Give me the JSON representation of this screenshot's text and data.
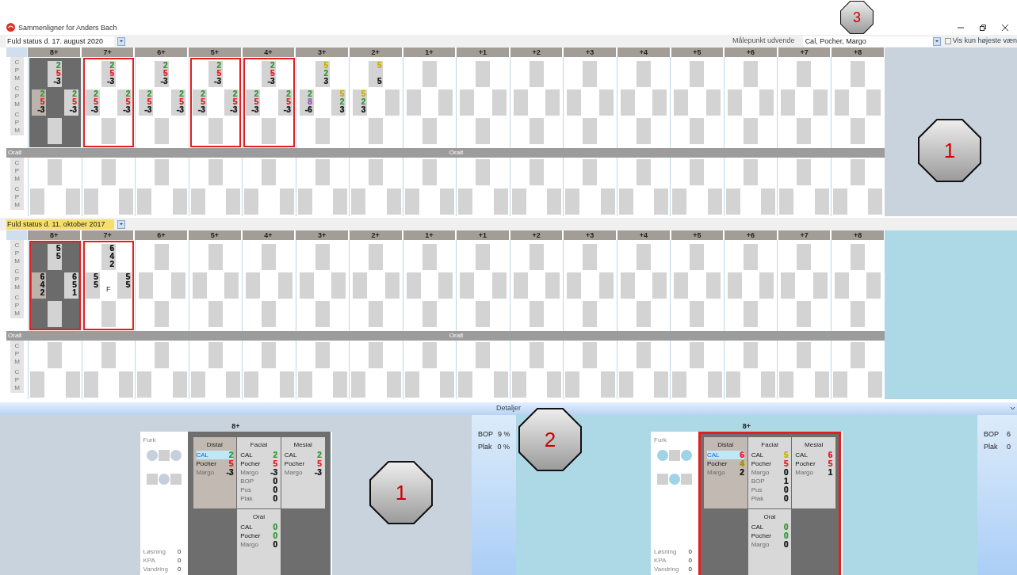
{
  "window": {
    "title": "Sammenligner for Anders Bach"
  },
  "toolbar": {
    "measure_label": "Målepunkt udvende",
    "measure_value": "Cal, Pocher, Margo",
    "highest_only": {
      "label": "Vis kun højeste væn",
      "checked": false
    }
  },
  "charts": [
    {
      "date": "Fuld status d. 17. august 2020",
      "date_highlighted": false,
      "oral_label": "Oralt",
      "oral_center_label": "Oralt",
      "buccal_row_labels": [
        [
          "C",
          "P",
          "M"
        ],
        [
          "C",
          "P",
          "M"
        ],
        [
          "C",
          "P",
          "M"
        ]
      ],
      "oral_row_labels": [
        [
          "C",
          "P",
          "M"
        ],
        [
          "C",
          "P",
          "M"
        ]
      ],
      "teeth": [
        {
          "label": "8+",
          "missing": true,
          "marked": false,
          "top": {
            "c": {
              "text": "2",
              "color": "#3c9a3c"
            },
            "p": {
              "text": "5",
              "color": "#e8262b"
            },
            "m": {
              "text": "-3",
              "color": "#222222"
            }
          },
          "left": {
            "c": {
              "text": "2",
              "color": "#3c9a3c"
            },
            "p": {
              "text": "5",
              "color": "#e8262b"
            },
            "m": {
              "text": "-3",
              "color": "#222222"
            }
          },
          "right": {
            "c": {
              "text": "2",
              "color": "#3c9a3c"
            },
            "p": {
              "text": "5",
              "color": "#e8262b"
            },
            "m": {
              "text": "-3",
              "color": "#222222"
            }
          }
        },
        {
          "label": "7+",
          "missing": false,
          "marked": true,
          "top": {
            "c": {
              "text": "2",
              "color": "#3c9a3c"
            },
            "p": {
              "text": "5",
              "color": "#e8262b"
            },
            "m": {
              "text": "-3",
              "color": "#222222"
            }
          },
          "left": {
            "c": {
              "text": "2",
              "color": "#3c9a3c"
            },
            "p": {
              "text": "5",
              "color": "#e8262b"
            },
            "m": {
              "text": "-3",
              "color": "#222222"
            }
          },
          "right": {
            "c": {
              "text": "2",
              "color": "#3c9a3c"
            },
            "p": {
              "text": "5",
              "color": "#e8262b"
            },
            "m": {
              "text": "-3",
              "color": "#222222"
            }
          }
        },
        {
          "label": "6+",
          "missing": false,
          "marked": false,
          "top": {
            "c": {
              "text": "2",
              "color": "#3c9a3c"
            },
            "p": {
              "text": "5",
              "color": "#e8262b"
            },
            "m": {
              "text": "-3",
              "color": "#222222"
            }
          },
          "left": {
            "c": {
              "text": "2",
              "color": "#3c9a3c"
            },
            "p": {
              "text": "5",
              "color": "#e8262b"
            },
            "m": {
              "text": "-3",
              "color": "#222222"
            }
          },
          "right": {
            "c": {
              "text": "2",
              "color": "#3c9a3c"
            },
            "p": {
              "text": "5",
              "color": "#e8262b"
            },
            "m": {
              "text": "-3",
              "color": "#222222"
            }
          }
        },
        {
          "label": "5+",
          "missing": false,
          "marked": true,
          "top": {
            "c": {
              "text": "2",
              "color": "#3c9a3c"
            },
            "p": {
              "text": "5",
              "color": "#e8262b"
            },
            "m": {
              "text": "-3",
              "color": "#222222"
            }
          },
          "left": {
            "c": {
              "text": "2",
              "color": "#3c9a3c"
            },
            "p": {
              "text": "5",
              "color": "#e8262b"
            },
            "m": {
              "text": "-3",
              "color": "#222222"
            }
          },
          "right": {
            "c": {
              "text": "2",
              "color": "#3c9a3c"
            },
            "p": {
              "text": "5",
              "color": "#e8262b"
            },
            "m": {
              "text": "-3",
              "color": "#222222"
            }
          }
        },
        {
          "label": "4+",
          "missing": false,
          "marked": true,
          "top": {
            "c": {
              "text": "2",
              "color": "#3c9a3c"
            },
            "p": {
              "text": "5",
              "color": "#e8262b"
            },
            "m": {
              "text": "-3",
              "color": "#222222"
            }
          },
          "left": {
            "c": {
              "text": "2",
              "color": "#3c9a3c"
            },
            "p": {
              "text": "5",
              "color": "#e8262b"
            },
            "m": {
              "text": "-3",
              "color": "#222222"
            }
          },
          "right": {
            "c": {
              "text": "2",
              "color": "#3c9a3c"
            },
            "p": {
              "text": "5",
              "color": "#e8262b"
            },
            "m": {
              "text": "-3",
              "color": "#222222"
            }
          }
        },
        {
          "label": "3+",
          "missing": false,
          "marked": false,
          "top": {
            "c": {
              "text": "5",
              "color": "#c9b400"
            },
            "p": {
              "text": "2",
              "color": "#3c9a3c"
            },
            "m": {
              "text": "3",
              "color": "#222222"
            }
          },
          "left": {
            "c": {
              "text": "2",
              "color": "#3c9a3c"
            },
            "p": {
              "text": "8",
              "color": "#9b59b6"
            },
            "m": {
              "text": "-6",
              "color": "#222222"
            }
          },
          "right": {
            "c": {
              "text": "5",
              "color": "#c9b400"
            },
            "p": {
              "text": "2",
              "color": "#3c9a3c"
            },
            "m": {
              "text": "3",
              "color": "#222222"
            }
          }
        },
        {
          "label": "2+",
          "missing": false,
          "marked": false,
          "top": {
            "c": {
              "text": "5",
              "color": "#c9b400"
            },
            "m": {
              "text": "5",
              "color": "#222222"
            }
          },
          "left": {
            "c": {
              "text": "5",
              "color": "#c9b400"
            },
            "p": {
              "text": "2",
              "color": "#3c9a3c"
            },
            "m": {
              "text": "3",
              "color": "#222222"
            }
          }
        },
        {
          "label": "1+",
          "missing": false,
          "marked": false
        },
        {
          "label": "+1",
          "missing": false,
          "marked": false
        },
        {
          "label": "+2",
          "missing": false,
          "marked": false
        },
        {
          "label": "+3",
          "missing": false,
          "marked": false
        },
        {
          "label": "+4",
          "missing": false,
          "marked": false
        },
        {
          "label": "+5",
          "missing": false,
          "marked": false
        },
        {
          "label": "+6",
          "missing": false,
          "marked": false
        },
        {
          "label": "+7",
          "missing": false,
          "marked": false
        },
        {
          "label": "+8",
          "missing": false,
          "marked": false
        }
      ]
    },
    {
      "date": "Fuld status d. 11. oktober 2017",
      "date_highlighted": true,
      "oral_label": "Oralt",
      "oral_center_label": "Oralt",
      "buccal_row_labels": [
        [
          "C",
          "P",
          "M"
        ],
        [
          "C",
          "P",
          "M"
        ],
        [
          "C",
          "P",
          "M"
        ]
      ],
      "oral_row_labels": [
        [
          "C",
          "P",
          "M"
        ],
        [
          "C",
          "P",
          "M"
        ]
      ],
      "teeth": [
        {
          "label": "8+",
          "missing": true,
          "marked": true,
          "top": {
            "c": {
              "text": "5",
              "color": "#222222"
            },
            "p": {
              "text": "5",
              "color": "#222222"
            }
          },
          "left": {
            "c": {
              "text": "6",
              "color": "#222222"
            },
            "p": {
              "text": "4",
              "color": "#222222"
            },
            "m": {
              "text": "2",
              "color": "#222222"
            }
          },
          "right": {
            "c": {
              "text": "6",
              "color": "#222222"
            },
            "p": {
              "text": "5",
              "color": "#222222"
            },
            "m": {
              "text": "1",
              "color": "#222222"
            }
          }
        },
        {
          "label": "7+",
          "missing": false,
          "marked": true,
          "top": {
            "c": {
              "text": "6",
              "color": "#222222"
            },
            "p": {
              "text": "4",
              "color": "#222222"
            },
            "m": {
              "text": "2",
              "color": "#222222"
            }
          },
          "left": {
            "c": {
              "text": "5",
              "color": "#222222"
            },
            "p": {
              "text": "5",
              "color": "#222222"
            }
          },
          "right": {
            "c": {
              "text": "5",
              "color": "#222222"
            },
            "p": {
              "text": "5",
              "color": "#222222"
            }
          },
          "center": "F"
        },
        {
          "label": "6+",
          "missing": false,
          "marked": false
        },
        {
          "label": "5+",
          "missing": false,
          "marked": false
        },
        {
          "label": "4+",
          "missing": false,
          "marked": false
        },
        {
          "label": "3+",
          "missing": false,
          "marked": false
        },
        {
          "label": "2+",
          "missing": false,
          "marked": false
        },
        {
          "label": "1+",
          "missing": false,
          "marked": false
        },
        {
          "label": "+1",
          "missing": false,
          "marked": false
        },
        {
          "label": "+2",
          "missing": false,
          "marked": false
        },
        {
          "label": "+3",
          "missing": false,
          "marked": false
        },
        {
          "label": "+4",
          "missing": false,
          "marked": false
        },
        {
          "label": "+5",
          "missing": false,
          "marked": false
        },
        {
          "label": "+6",
          "missing": false,
          "marked": false
        },
        {
          "label": "+7",
          "missing": false,
          "marked": false
        },
        {
          "label": "+8",
          "missing": false,
          "marked": false
        }
      ]
    }
  ],
  "details": {
    "title": "Detaljer",
    "panels": [
      {
        "tooth": "8+",
        "marked": false,
        "furcation": {
          "label": "Furk",
          "color": "#c5d0dc"
        },
        "sections": [
          {
            "name": "Distal",
            "selected": true,
            "rows": [
              {
                "label": "CAL",
                "value": "2",
                "color": "#3c9a3c",
                "dim": false,
                "selected": true
              },
              {
                "label": "Pocher",
                "value": "5",
                "color": "#e8262b",
                "dim": false,
                "selected": false
              },
              {
                "label": "Margo",
                "value": "-3",
                "color": "#222222",
                "dim": true,
                "selected": false
              }
            ]
          },
          {
            "name": "Facial",
            "selected": false,
            "rows": [
              {
                "label": "CAL",
                "value": "2",
                "color": "#3c9a3c",
                "dim": false,
                "selected": false
              },
              {
                "label": "Pocher",
                "value": "5",
                "color": "#e8262b",
                "dim": false,
                "selected": false
              },
              {
                "label": "Margo",
                "value": "-3",
                "color": "#222222",
                "dim": true,
                "selected": false
              },
              {
                "label": "BOP",
                "value": "0",
                "color": "#222222",
                "dim": true,
                "selected": false
              },
              {
                "label": "Pus",
                "value": "0",
                "color": "#222222",
                "dim": true,
                "selected": false
              },
              {
                "label": "Plak",
                "value": "0",
                "color": "#222222",
                "dim": true,
                "selected": false
              }
            ]
          },
          {
            "name": "Mesial",
            "selected": false,
            "rows": [
              {
                "label": "CAL",
                "value": "2",
                "color": "#3c9a3c",
                "dim": false,
                "selected": false
              },
              {
                "label": "Pocher",
                "value": "5",
                "color": "#e8262b",
                "dim": false,
                "selected": false
              },
              {
                "label": "Margo",
                "value": "-3",
                "color": "#222222",
                "dim": true,
                "selected": false
              }
            ]
          },
          {
            "name": "Oral",
            "selected": false,
            "rows": [
              {
                "label": "CAL",
                "value": "0",
                "color": "#3c9a3c",
                "dim": false,
                "selected": false
              },
              {
                "label": "Pocher",
                "value": "0",
                "color": "#3c9a3c",
                "dim": false,
                "selected": false
              },
              {
                "label": "Margo",
                "value": "0",
                "color": "#222222",
                "dim": true,
                "selected": false
              }
            ]
          }
        ],
        "stats": [
          {
            "label": "Løsning",
            "value": "0"
          },
          {
            "label": "KPA",
            "value": "0"
          },
          {
            "label": "Vandring",
            "value": "0"
          }
        ],
        "summary": [
          {
            "label": "BOP",
            "value": "9 %"
          },
          {
            "label": "Plak",
            "value": "0 %"
          }
        ]
      },
      {
        "tooth": "8+",
        "marked": true,
        "furcation": {
          "label": "Furk",
          "color": "#9fd4e6"
        },
        "sections": [
          {
            "name": "Distal",
            "selected": true,
            "rows": [
              {
                "label": "CAL",
                "value": "6",
                "color": "#e8262b",
                "dim": false,
                "selected": true
              },
              {
                "label": "Pocher",
                "value": "4",
                "color": "#a89200",
                "dim": false,
                "selected": false
              },
              {
                "label": "Margo",
                "value": "2",
                "color": "#222222",
                "dim": true,
                "selected": false
              }
            ]
          },
          {
            "name": "Facial",
            "selected": false,
            "rows": [
              {
                "label": "CAL",
                "value": "5",
                "color": "#c9b400",
                "dim": false,
                "selected": false
              },
              {
                "label": "Pocher",
                "value": "5",
                "color": "#e8262b",
                "dim": false,
                "selected": false
              },
              {
                "label": "Margo",
                "value": "0",
                "color": "#222222",
                "dim": true,
                "selected": false
              },
              {
                "label": "BOP",
                "value": "1",
                "color": "#222222",
                "dim": true,
                "selected": false
              },
              {
                "label": "Pus",
                "value": "0",
                "color": "#222222",
                "dim": true,
                "selected": false
              },
              {
                "label": "Plak",
                "value": "0",
                "color": "#222222",
                "dim": true,
                "selected": false
              }
            ]
          },
          {
            "name": "Mesial",
            "selected": false,
            "rows": [
              {
                "label": "CAL",
                "value": "6",
                "color": "#e8262b",
                "dim": false,
                "selected": false
              },
              {
                "label": "Pocher",
                "value": "5",
                "color": "#e8262b",
                "dim": false,
                "selected": false
              },
              {
                "label": "Margo",
                "value": "1",
                "color": "#222222",
                "dim": true,
                "selected": false
              }
            ]
          },
          {
            "name": "Oral",
            "selected": false,
            "rows": [
              {
                "label": "CAL",
                "value": "0",
                "color": "#3c9a3c",
                "dim": false,
                "selected": false
              },
              {
                "label": "Pocher",
                "value": "0",
                "color": "#3c9a3c",
                "dim": false,
                "selected": false
              },
              {
                "label": "Margo",
                "value": "0",
                "color": "#222222",
                "dim": true,
                "selected": false
              }
            ]
          }
        ],
        "stats": [
          {
            "label": "Løsning",
            "value": "0"
          },
          {
            "label": "KPA",
            "value": "0"
          },
          {
            "label": "Vandring",
            "value": "0"
          }
        ],
        "summary": [
          {
            "label": "BOP",
            "value": "6"
          },
          {
            "label": "Plak",
            "value": "0"
          }
        ]
      }
    ]
  },
  "callouts": [
    {
      "number": "3"
    },
    {
      "number": "1"
    },
    {
      "number": "2"
    },
    {
      "number": "1"
    }
  ]
}
